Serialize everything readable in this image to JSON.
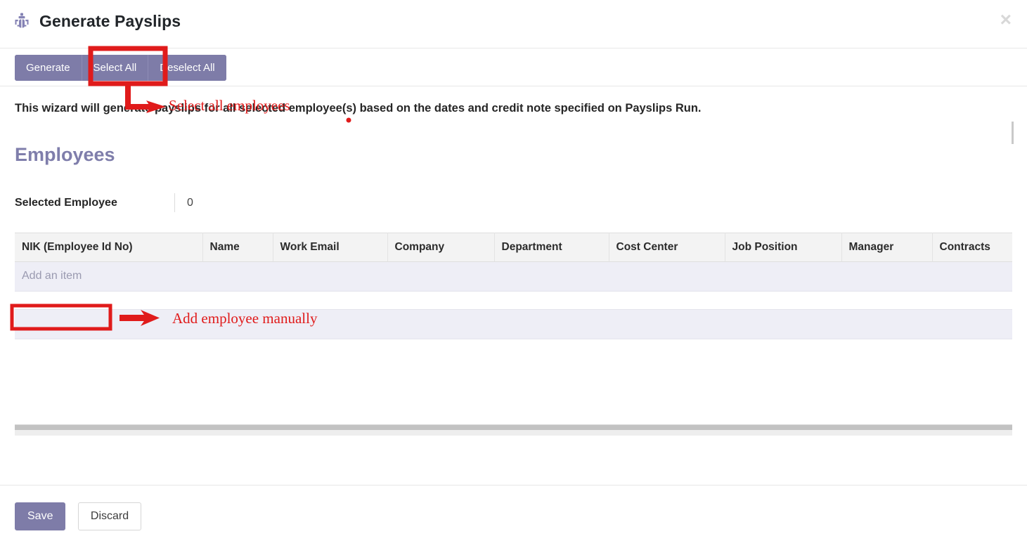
{
  "dialog": {
    "title": "Generate Payslips",
    "icon": "bug-icon",
    "close_label": "×",
    "accent_color": "#7e7ca8",
    "annotation_color": "#e01b1b"
  },
  "toolbar": {
    "buttons": [
      {
        "label": "Generate",
        "name": "generate-button"
      },
      {
        "label": "Select All",
        "name": "select-all-button",
        "highlighted": true
      },
      {
        "label": "Deselect All",
        "name": "deselect-all-button"
      }
    ]
  },
  "body": {
    "description": "This wizard will generate payslips for all selected employee(s) based on the dates and credit note specified on Payslips Run.",
    "section_title": "Employees",
    "selected_employee": {
      "label": "Selected Employee",
      "value": "0"
    }
  },
  "table": {
    "columns": [
      "NIK (Employee Id No)",
      "Name",
      "Work Email",
      "Company",
      "Department",
      "Cost Center",
      "Job Position",
      "Manager",
      "Contracts"
    ],
    "rows": [],
    "add_item_label": "Add an item"
  },
  "footer": {
    "save_label": "Save",
    "discard_label": "Discard"
  },
  "annotations": [
    {
      "text": "Select all employees",
      "target": "select-all-button"
    },
    {
      "text": "Add employee manually",
      "target": "add-an-item-cell"
    }
  ]
}
